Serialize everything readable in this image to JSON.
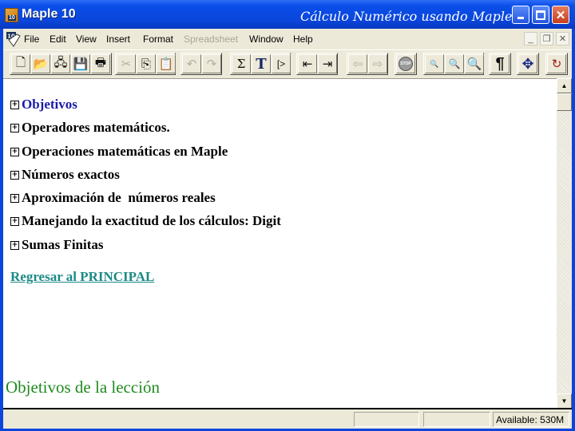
{
  "window": {
    "app_title": "Maple 10",
    "app_icon_badge": "10",
    "caption": "Cálculo Numérico usando Maple.",
    "controls": {
      "minimize": "minimize",
      "maximize": "maximize",
      "close": "✕"
    }
  },
  "menubar": {
    "items": [
      {
        "label": "File",
        "enabled": true
      },
      {
        "label": "Edit",
        "enabled": true
      },
      {
        "label": "View",
        "enabled": true
      },
      {
        "label": "Insert",
        "enabled": true
      },
      {
        "label": "Format",
        "enabled": true
      },
      {
        "label": "Spreadsheet",
        "enabled": false
      },
      {
        "label": "Window",
        "enabled": true
      },
      {
        "label": "Help",
        "enabled": true
      }
    ],
    "mdi_controls": {
      "minimize": "_",
      "restore": "❐",
      "close": "✕"
    }
  },
  "toolbar": {
    "buttons": [
      {
        "name": "new-document",
        "glyph": "🗋",
        "enabled": true
      },
      {
        "name": "open",
        "glyph": "📂",
        "enabled": true
      },
      {
        "name": "open-url",
        "glyph": "🖧",
        "enabled": true
      },
      {
        "name": "save",
        "glyph": "💾",
        "enabled": true
      },
      {
        "name": "print",
        "glyph": "🖶",
        "enabled": true
      },
      {
        "name": "cut",
        "glyph": "✂",
        "enabled": false
      },
      {
        "name": "copy",
        "glyph": "⎘",
        "enabled": true
      },
      {
        "name": "paste",
        "glyph": "📋",
        "enabled": true
      },
      {
        "name": "undo",
        "glyph": "↶",
        "enabled": false
      },
      {
        "name": "redo",
        "glyph": "↷",
        "enabled": false
      },
      {
        "name": "math-input",
        "glyph": "Σ",
        "enabled": true
      },
      {
        "name": "text-input",
        "glyph": "T",
        "enabled": true
      },
      {
        "name": "execution-group",
        "glyph": "[>",
        "enabled": true
      },
      {
        "name": "outdent",
        "glyph": "⇤",
        "enabled": true
      },
      {
        "name": "indent",
        "glyph": "⇥",
        "enabled": true
      },
      {
        "name": "back",
        "glyph": "⇦",
        "enabled": false
      },
      {
        "name": "forward",
        "glyph": "⇨",
        "enabled": false
      },
      {
        "name": "stop",
        "glyph": "STOP",
        "enabled": false
      },
      {
        "name": "zoom-small",
        "glyph": "🔍",
        "enabled": true
      },
      {
        "name": "zoom-medium",
        "glyph": "🔍",
        "enabled": true
      },
      {
        "name": "zoom-large",
        "glyph": "🔍",
        "enabled": true
      },
      {
        "name": "show-markers",
        "glyph": "¶",
        "enabled": true
      },
      {
        "name": "expand",
        "glyph": "✥",
        "enabled": true
      },
      {
        "name": "restart",
        "glyph": "↻",
        "enabled": true
      }
    ]
  },
  "document": {
    "sections": [
      {
        "label": "Objetivos",
        "expander": "+"
      },
      {
        "label": "Operadores matemáticos.",
        "expander": "+"
      },
      {
        "label": "Operaciones matemáticas en Maple",
        "expander": "+"
      },
      {
        "label": "Números exactos",
        "expander": "+"
      },
      {
        "label": "Aproximación de  números reales",
        "expander": "+"
      },
      {
        "label": "Manejando la exactitud de los cálculos: Digit",
        "expander": "+"
      },
      {
        "label": "Sumas Finitas",
        "expander": "+"
      }
    ],
    "link": "Regresar al PRINCIPAL",
    "footer_caption": "Objetivos de la lección"
  },
  "scrollbar": {
    "up": "▲",
    "down": "▼"
  },
  "statusbar": {
    "panel1": "",
    "panel2": "",
    "memory": "Available: 530M"
  }
}
